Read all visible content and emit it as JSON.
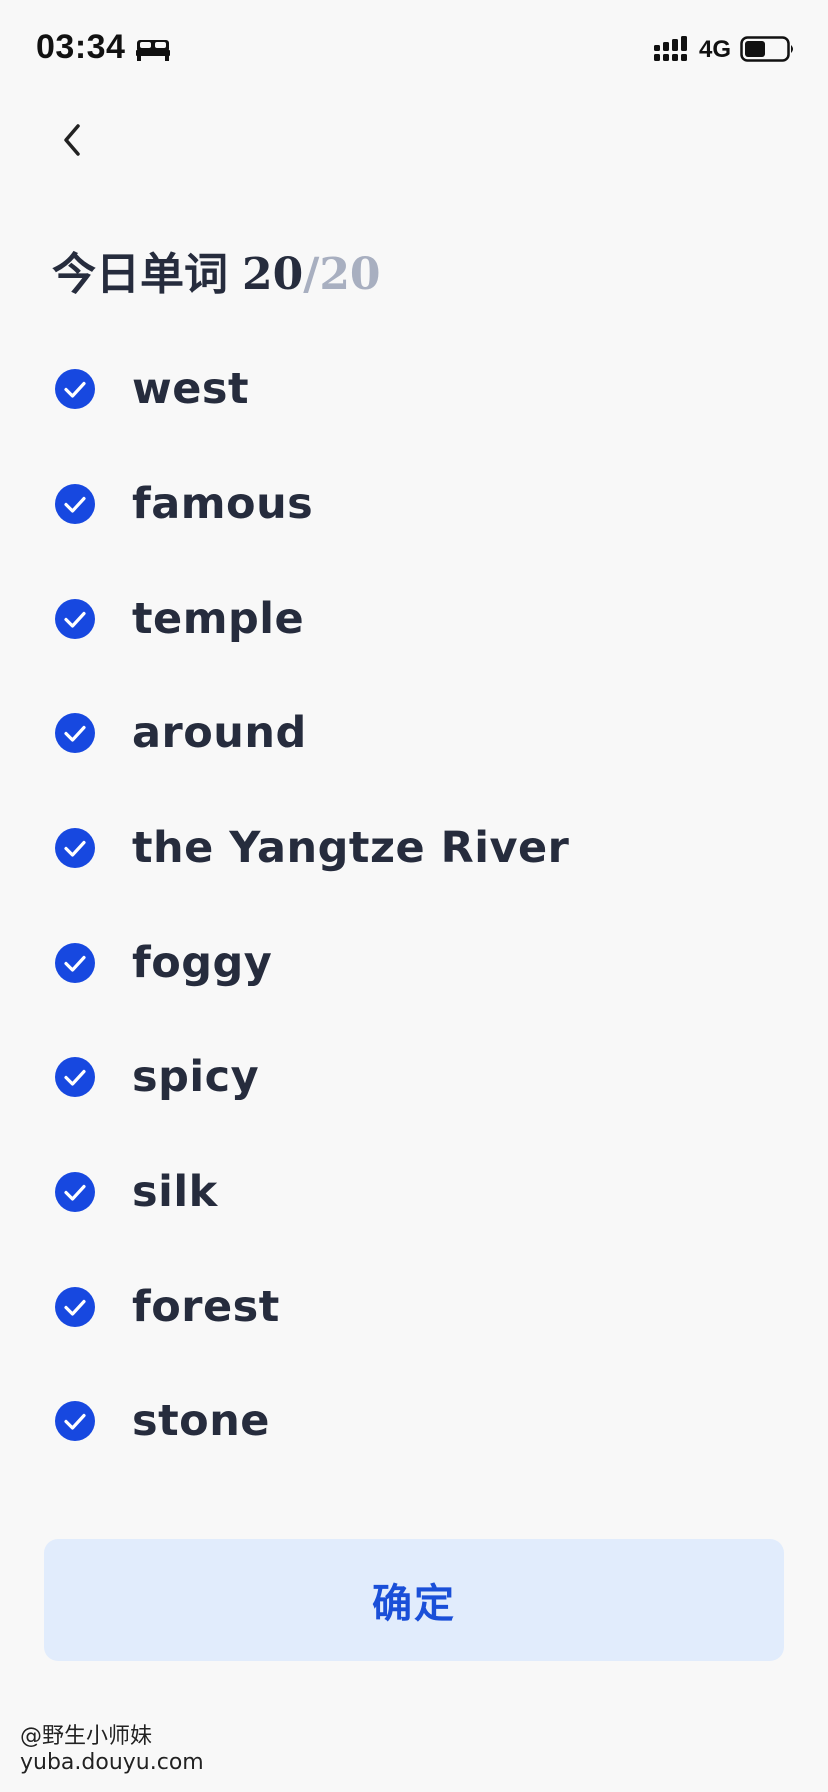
{
  "status_bar": {
    "time": "03:34",
    "network": "4G",
    "battery_fill": 0.5,
    "icons": [
      "bed-icon",
      "signal-icon",
      "battery-icon"
    ]
  },
  "header": {
    "back_icon": "chevron-left-icon",
    "title": "今日单词",
    "progress_current": "20",
    "progress_separator": "/",
    "progress_total": "20"
  },
  "words": [
    {
      "label": "west",
      "checked": true
    },
    {
      "label": "famous",
      "checked": true
    },
    {
      "label": "temple",
      "checked": true
    },
    {
      "label": "around",
      "checked": true
    },
    {
      "label": "the Yangtze River",
      "checked": true
    },
    {
      "label": "foggy",
      "checked": true
    },
    {
      "label": "spicy",
      "checked": true
    },
    {
      "label": "silk",
      "checked": true
    },
    {
      "label": "forest",
      "checked": true
    },
    {
      "label": "stone",
      "checked": true
    }
  ],
  "confirm_button": {
    "label": "确定"
  },
  "watermark": {
    "line1": "@野生小师妹",
    "line2": "yuba.douyu.com"
  },
  "colors": {
    "accent": "#1a4fd8",
    "check": "#1748e0",
    "button_bg": "#e1ecfc",
    "text": "#262c3d",
    "muted": "#a8afc0",
    "background": "#f8f8f8"
  }
}
